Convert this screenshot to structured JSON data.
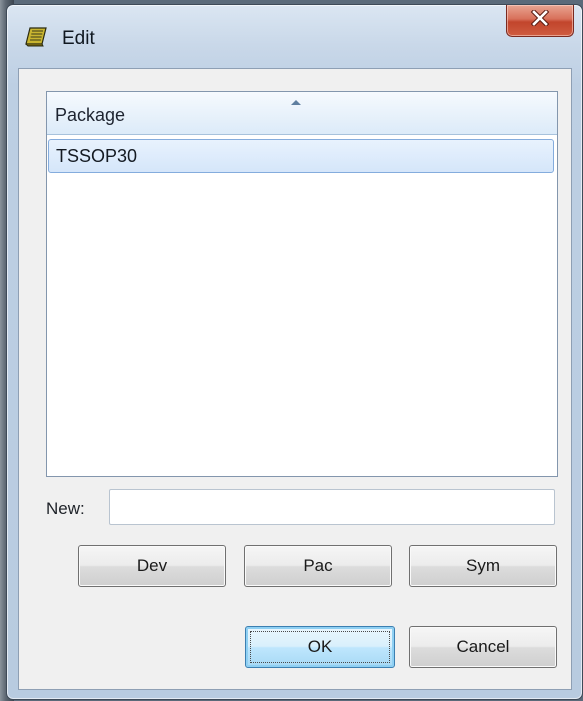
{
  "window": {
    "title": "Edit",
    "icon": "book-icon",
    "close_glyph": "x"
  },
  "listview": {
    "columns": [
      {
        "label": "Package",
        "sort": "ascending"
      }
    ],
    "rows": [
      {
        "label": "TSSOP30",
        "selected": true
      }
    ]
  },
  "new_field": {
    "label": "New:",
    "value": "",
    "placeholder": ""
  },
  "buttons": {
    "dev": "Dev",
    "pac": "Pac",
    "sym": "Sym",
    "ok": "OK",
    "cancel": "Cancel"
  },
  "colors": {
    "close_button": "#c9503a",
    "selection": "#d5e6fa",
    "default_button": "#bee6fd"
  }
}
